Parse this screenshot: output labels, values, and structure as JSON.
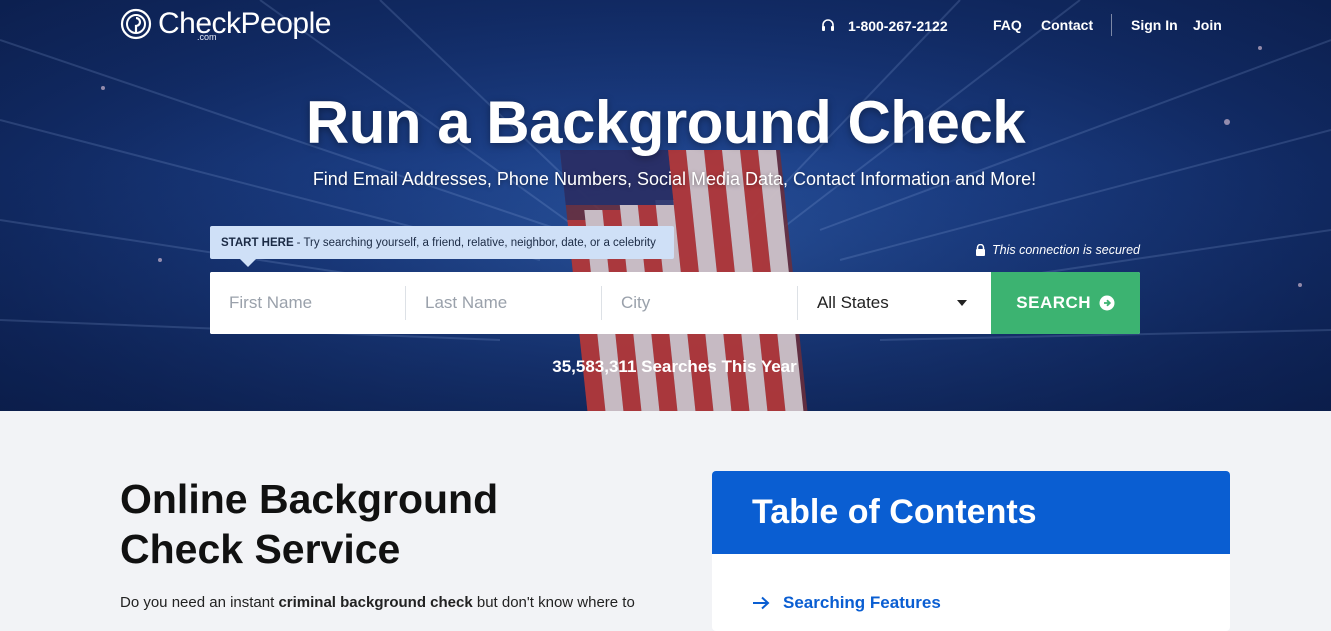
{
  "header": {
    "logo_text": "CheckPeople",
    "logo_suffix": ".com",
    "phone": "1-800-267-2122",
    "nav": {
      "faq": "FAQ",
      "contact": "Contact",
      "signin": "Sign In",
      "join": "Join"
    }
  },
  "hero": {
    "title": "Run a Background Check",
    "subtitle": "Find Email Addresses, Phone Numbers, Social Media Data, Contact Information and More!",
    "tip_label": "START HERE",
    "tip_text": " - Try searching yourself, a friend, relative, neighbor, date, or a celebrity",
    "secure_text": "This connection is secured",
    "search": {
      "first_name_placeholder": "First Name",
      "last_name_placeholder": "Last Name",
      "city_placeholder": "City",
      "state_value": "All States",
      "button_label": "SEARCH"
    },
    "count_text": "35,583,311 Searches This Year"
  },
  "main": {
    "title": "Online Background Check Service",
    "intro_before": "Do you need an instant ",
    "intro_bold": "criminal background check",
    "intro_after": " but don't know where to"
  },
  "toc": {
    "title": "Table of Contents",
    "items": [
      {
        "label": "Searching Features"
      }
    ]
  },
  "colors": {
    "search_button": "#3cb371",
    "toc_header": "#0a5ed2",
    "tip_bg": "#cfe0f7",
    "page_bg": "#f2f3f6"
  },
  "icons": [
    "logo-mark-icon",
    "headset-icon",
    "lock-icon",
    "caret-down-icon",
    "arrow-circle-right-icon",
    "arrow-right-icon"
  ]
}
